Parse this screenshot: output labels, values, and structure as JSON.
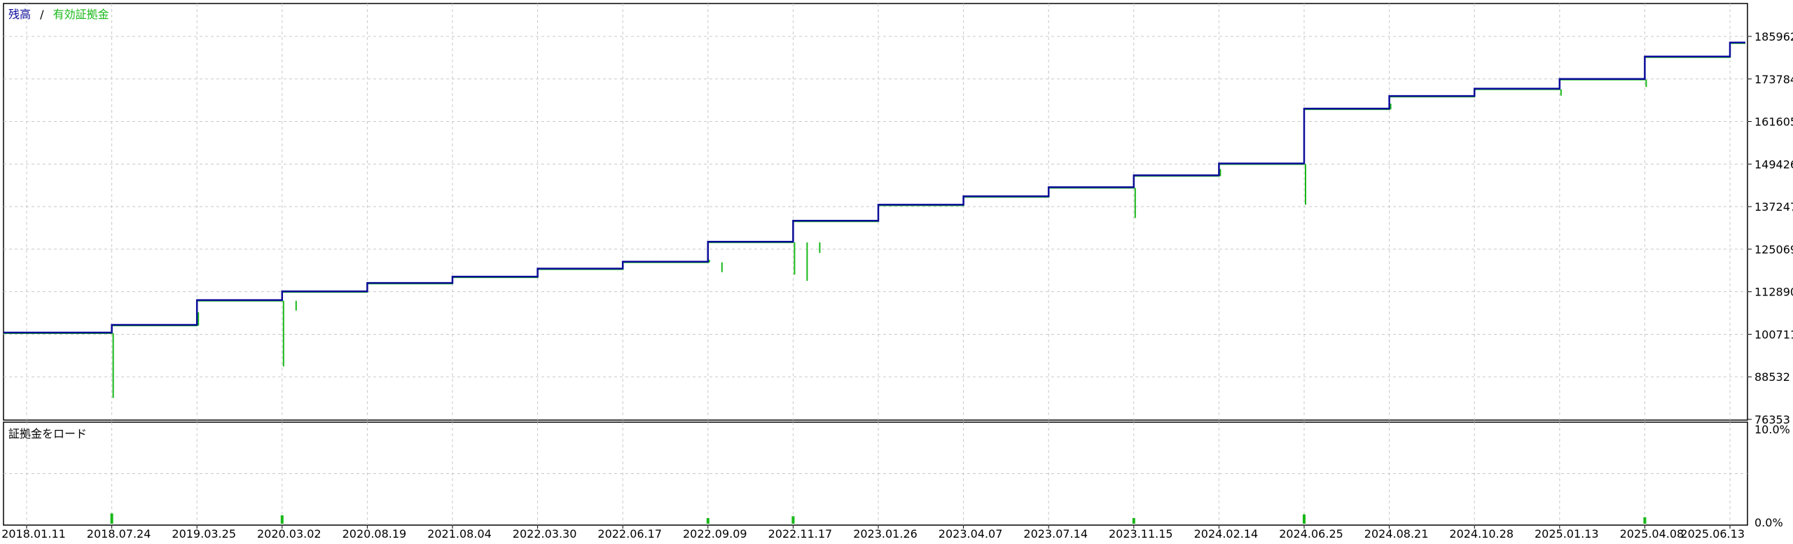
{
  "colors": {
    "balance": "#0b0b9a",
    "equity": "#18b818",
    "load": "#18b818",
    "grid": "#c8c8c8",
    "frame": "#000000",
    "background": "#ffffff"
  },
  "chart_data": [
    {
      "type": "line",
      "legend": {
        "balance": "残高",
        "separator": "/",
        "equity": "有効証拠金",
        "placement": "top-left"
      },
      "y_ticks": [
        "185962",
        "173784",
        "161605",
        "149426",
        "137247",
        "125069",
        "112890",
        "100711",
        "88532",
        "76353"
      ],
      "ylim": [
        76353,
        185962
      ],
      "grid": true,
      "x": [
        "2018.01.11",
        "2018.07.24",
        "2019.03.25",
        "2020.03.02",
        "2020.08.19",
        "2021.08.04",
        "2022.03.30",
        "2022.06.17",
        "2022.09.09",
        "2022.11.17",
        "2023.01.26",
        "2023.04.07",
        "2023.07.14",
        "2023.11.15",
        "2024.02.14",
        "2024.06.25",
        "2024.08.21",
        "2024.10.28",
        "2025.01.13",
        "2025.04.08",
        "2025.06.13"
      ],
      "series": [
        {
          "name": "残高",
          "values": [
            101200,
            103400,
            110500,
            113000,
            115400,
            117200,
            119500,
            121500,
            127200,
            133200,
            137800,
            140200,
            142800,
            146200,
            149600,
            165300,
            168900,
            171000,
            173800,
            180200,
            184200
          ]
        },
        {
          "name": "有効証拠金",
          "values": [
            101000,
            103200,
            110300,
            112800,
            115200,
            117000,
            119300,
            121300,
            127000,
            133000,
            137600,
            140000,
            142600,
            146000,
            149400,
            165100,
            168700,
            170800,
            173600,
            180000,
            184000
          ]
        }
      ],
      "equity_dips": [
        {
          "date": "2018.07.24",
          "value": 82500
        },
        {
          "date": "2019.03.25",
          "value": 107000
        },
        {
          "date": "2020.03.02",
          "value": 91500
        },
        {
          "date": "2020.03.02",
          "value": 107500
        },
        {
          "date": "2022.09.09",
          "value": 122000
        },
        {
          "date": "2022.09.09",
          "value": 118500
        },
        {
          "date": "2022.11.17",
          "value": 117800
        },
        {
          "date": "2022.11.17",
          "value": 116000
        },
        {
          "date": "2022.11.17",
          "value": 124000
        },
        {
          "date": "2023.11.15",
          "value": 134000
        },
        {
          "date": "2024.02.14",
          "value": 148000
        },
        {
          "date": "2024.06.25",
          "value": 137800
        },
        {
          "date": "2024.08.21",
          "value": 166700
        },
        {
          "date": "2025.01.13",
          "value": 169000
        },
        {
          "date": "2025.04.08",
          "value": 171500
        }
      ]
    },
    {
      "type": "bar",
      "label": "証拠金をロード",
      "y_ticks": [
        "10.0%",
        "0.0%"
      ],
      "ylim": [
        0,
        10
      ],
      "x": [
        "2018.07.24",
        "2020.03.02",
        "2022.09.09",
        "2022.11.17",
        "2023.11.15",
        "2024.06.25",
        "2025.04.08"
      ],
      "values": [
        1.1,
        0.9,
        0.6,
        0.8,
        0.6,
        1.0,
        0.7
      ]
    }
  ]
}
